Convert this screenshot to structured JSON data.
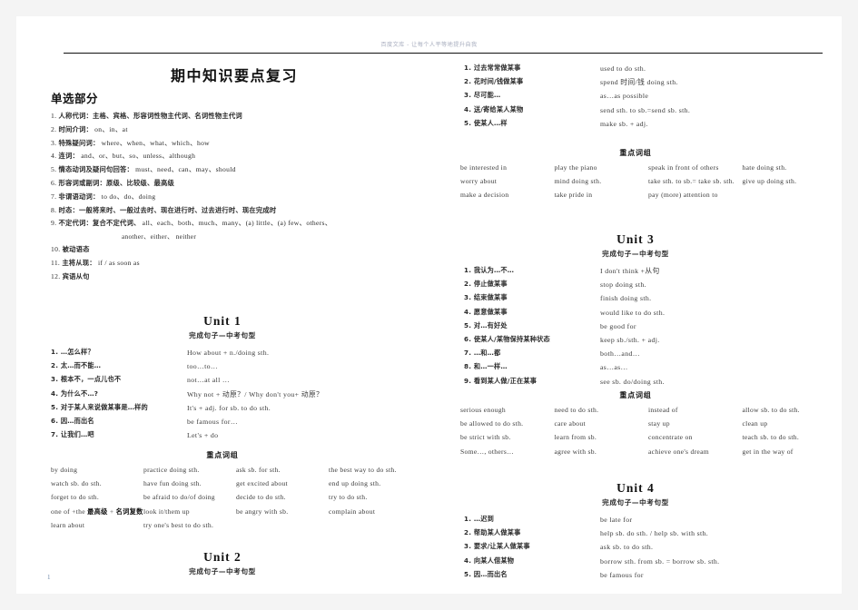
{
  "document": {
    "watermark": "百度文库 - 让每个人平等地提升自我",
    "title": "期中知识要点复习",
    "page_number": "1"
  },
  "left_column": {
    "section_heading": "单选部分",
    "grammar_points": [
      {
        "num": "1.",
        "cn": "人称代词：主格、宾格、形容词性物主代词、名词性物主代词",
        "en": ""
      },
      {
        "num": "2.",
        "cn": "时间介词：",
        "en": "on、in、at"
      },
      {
        "num": "3.",
        "cn": "特殊疑问词：",
        "en": "where、when、what、which、how"
      },
      {
        "num": "4.",
        "cn": "连词：",
        "en": "and、or、but、so、unless、although"
      },
      {
        "num": "5.",
        "cn": "情态动词及疑问句回答：",
        "en": "must、need、can、may、should"
      },
      {
        "num": "6.",
        "cn": "形容词或副词：原级、比较级、最高级",
        "en": ""
      },
      {
        "num": "7.",
        "cn": "非谓语动词：",
        "en": "to do、do、doing"
      },
      {
        "num": "8.",
        "cn": "时态：一般将来时、一般过去时、现在进行时、过去进行时、现在完成时",
        "en": ""
      },
      {
        "num": "9.",
        "cn": "不定代词：复合不定代词、",
        "en": "all、each、both、much、many、(a) little、(a) few、others、"
      },
      {
        "num": "10.",
        "cn": "被动语态",
        "en": ""
      },
      {
        "num": "11.",
        "cn": "主将从现：",
        "en": "if / as soon as"
      },
      {
        "num": "12.",
        "cn": "宾语从句",
        "en": ""
      }
    ],
    "grammar_point_9_continuation": "another、either、  neither",
    "unit1": {
      "title": "Unit  1",
      "subtitle": "完成句子—中考句型",
      "pairs": [
        {
          "num": "1.",
          "cn": "…怎么样？",
          "en": "How about + n./doing sth."
        },
        {
          "num": "2.",
          "cn": "太…而不能…",
          "en": "too…to…"
        },
        {
          "num": "3.",
          "cn": "根本不，一点儿也不",
          "en": "not…at all …"
        },
        {
          "num": "4.",
          "cn": "为什么不…?",
          "en": "Why not +  动原？/ Why don't you+  动原？"
        },
        {
          "num": "5.",
          "cn": "对于某人来说做某事是…样的",
          "en": "It's + adj. for sb. to do sth."
        },
        {
          "num": "6.",
          "cn": "因…而出名",
          "en": "be famous for…"
        },
        {
          "num": "7.",
          "cn": "让我们…吧",
          "en": "Let's + do"
        }
      ],
      "phrase_heading": "重点词组",
      "phrases": [
        "by doing",
        "practice doing sth.",
        "ask sb. for sth.",
        "the best way to do sth.",
        "watch sb. do sth.",
        "have fun doing sth.",
        "get excited about",
        "end up doing sth.",
        "forget to do sth.",
        "be afraid to do/of doing",
        "decide to do sth.",
        "try to do sth.",
        "one of +the  最高级 +  名词复数",
        "look it/them up",
        "be angry with sb.",
        "complain about",
        "learn about",
        "try one's best to do sth."
      ]
    },
    "unit2": {
      "title": "Unit  2",
      "subtitle": "完成句子—中考句型"
    }
  },
  "right_column": {
    "unit2_pairs": [
      {
        "num": "1.",
        "cn": "过去常常做某事",
        "en": "used to do sth."
      },
      {
        "num": "2.",
        "cn": "花时间/钱做某事",
        "en": "spend  时间/钱 doing sth."
      },
      {
        "num": "3.",
        "cn": "尽可能…",
        "en": "as…as possible"
      },
      {
        "num": "4.",
        "cn": "送/寄给某人某物",
        "en": "send sth. to sb.=send sb. sth."
      },
      {
        "num": "5.",
        "cn": "使某人…样",
        "en": "make sb. + adj."
      }
    ],
    "unit2_phrase_heading": "重点词组",
    "unit2_phrases": [
      "be interested in",
      "play the piano",
      "speak in front of others",
      "hate doing sth.",
      "worry about",
      "mind doing sth.",
      "take sth. to sb.= take sb. sth.",
      "give up doing sth.",
      "make a decision",
      "take pride in",
      "pay (more) attention to",
      ""
    ],
    "unit3": {
      "title": "Unit  3",
      "subtitle": "完成句子—中考句型",
      "pairs": [
        {
          "num": "1.",
          "cn": "我认为…不…",
          "en": "I don't think +从句"
        },
        {
          "num": "2.",
          "cn": "停止做某事",
          "en": "stop doing sth."
        },
        {
          "num": "3.",
          "cn": "结束做某事",
          "en": "finish doing sth."
        },
        {
          "num": "4.",
          "cn": "愿意做某事",
          "en": "would like to do sth."
        },
        {
          "num": "5.",
          "cn": "对…有好处",
          "en": "be good for"
        },
        {
          "num": "6.",
          "cn": "使某人/某物保持某种状态",
          "en": "keep sb./sth. + adj."
        },
        {
          "num": "7.",
          "cn": "…和…都",
          "en": "both…and…"
        },
        {
          "num": "8.",
          "cn": "和…一样…",
          "en": "as…as…"
        },
        {
          "num": "9.",
          "cn": "看到某人做/正在某事",
          "en": "see sb. do/doing sth."
        }
      ],
      "phrase_heading": "重点词组",
      "phrases": [
        "serious enough",
        "need to do sth.",
        "instead of",
        "allow sb. to do sth.",
        "be allowed to do sth.",
        "care about",
        "stay up",
        "clean up",
        "be strict with sb.",
        "learn from sb.",
        "concentrate on",
        "teach sb. to do sth.",
        "Some…, others…",
        "agree with sb.",
        "achieve one's dream",
        "get in the way of"
      ]
    },
    "unit4": {
      "title": "Unit  4",
      "subtitle": "完成句子—中考句型",
      "pairs": [
        {
          "num": "1.",
          "cn": "…迟到",
          "en": "be late for"
        },
        {
          "num": "2.",
          "cn": "帮助某人做某事",
          "en": "help sb. do sth. / help sb. with sth."
        },
        {
          "num": "3.",
          "cn": "要求/让某人做某事",
          "en": "ask sb. to do sth."
        },
        {
          "num": "4.",
          "cn": "向某人借某物",
          "en": "borrow sth. from sb. = borrow sb. sth."
        },
        {
          "num": "5.",
          "cn": "因…而出名",
          "en": "be famous for"
        }
      ]
    }
  }
}
